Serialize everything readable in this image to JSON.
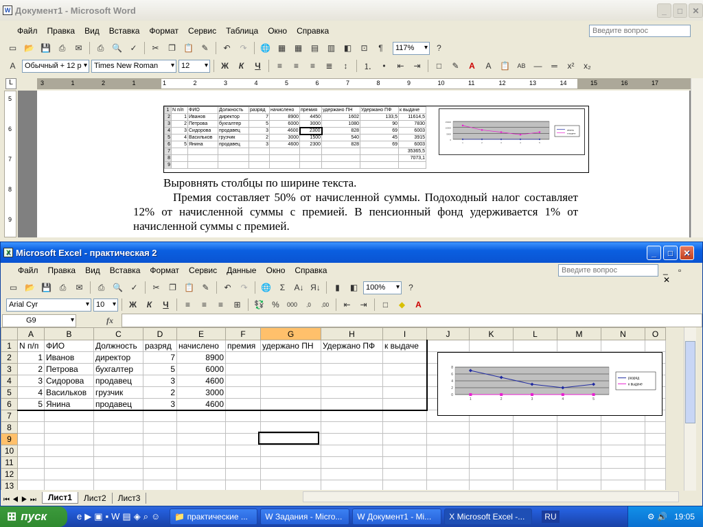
{
  "word": {
    "title": "Документ1 - Microsoft Word",
    "menu": [
      "Файл",
      "Правка",
      "Вид",
      "Вставка",
      "Формат",
      "Сервис",
      "Таблица",
      "Окно",
      "Справка"
    ],
    "help_placeholder": "Введите вопрос",
    "zoom": "117%",
    "style": "Обычный + 12 р",
    "font": "Times New Roman",
    "size": "12",
    "ruler_marks": [
      "3",
      "1",
      "2",
      "1",
      "1",
      "2",
      "3",
      "4",
      "5",
      "6",
      "7",
      "8",
      "9",
      "10",
      "11",
      "12",
      "13",
      "14",
      "15",
      "16",
      "17"
    ],
    "vruler_marks": [
      "5",
      "6",
      "7",
      "8",
      "9"
    ],
    "embedded": {
      "cols": [
        "",
        "N п/п",
        "ФИО",
        "Должность",
        "разряд",
        "начислено",
        "премия",
        "удержано ПН",
        "Удержано ПФ",
        "к выдаче"
      ],
      "rows": [
        [
          "1",
          "N п/п",
          "ФИО",
          "Должность",
          "разряд",
          "начислено",
          "премия",
          "удержано ПН",
          "Удержано ПФ",
          "к выдаче"
        ],
        [
          "2",
          "1",
          "Иванов",
          "директор",
          "7",
          "8900",
          "4450",
          "1602",
          "133,5",
          "11614,5"
        ],
        [
          "3",
          "2",
          "Петрова",
          "бухгалтер",
          "5",
          "6000",
          "3000",
          "1080",
          "90",
          "7830"
        ],
        [
          "4",
          "3",
          "Сидорова",
          "продавец",
          "3",
          "4600",
          "2300",
          "828",
          "69",
          "6003"
        ],
        [
          "5",
          "4",
          "Васильков",
          "грузчик",
          "2",
          "3000",
          "1500",
          "540",
          "45",
          "3915"
        ],
        [
          "6",
          "5",
          "Янина",
          "продавец",
          "3",
          "4600",
          "2300",
          "828",
          "69",
          "6003"
        ],
        [
          "7",
          "",
          "",
          "",
          "",
          "",
          "",
          "",
          "",
          "35365,5"
        ],
        [
          "8",
          "",
          "",
          "",
          "",
          "",
          "",
          "",
          "",
          "7073,1"
        ],
        [
          "9",
          "",
          "",
          "",
          "",
          "",
          "",
          "",
          "",
          ""
        ]
      ]
    },
    "text1": "Выровнять столбцы по ширине текста.",
    "text2": "Премия составляет 50% от начисленной суммы. Подоходный налог составляет 12% от начисленной суммы с премией. В пенсионный фонд удерживается 1% от начисленной суммы с премией."
  },
  "excel": {
    "title": "Microsoft Excel - практическая 2",
    "menu": [
      "Файл",
      "Правка",
      "Вид",
      "Вставка",
      "Формат",
      "Сервис",
      "Данные",
      "Окно",
      "Справка"
    ],
    "help_placeholder": "Введите вопрос",
    "zoom": "100%",
    "font": "Arial Cyr",
    "size": "10",
    "namebox": "G9",
    "fx": "fx",
    "columns": [
      "A",
      "B",
      "C",
      "D",
      "E",
      "F",
      "G",
      "H",
      "I",
      "J",
      "K",
      "L",
      "M",
      "N",
      "O"
    ],
    "rows": [
      [
        "1",
        "N п/п",
        "ФИО",
        "Должность",
        "разряд",
        "начислено",
        "премия",
        "удержано ПН",
        "Удержано ПФ",
        "к выдаче"
      ],
      [
        "2",
        "1",
        "Иванов",
        "директор",
        "7",
        "8900",
        "",
        "",
        "",
        ""
      ],
      [
        "3",
        "2",
        "Петрова",
        "бухгалтер",
        "5",
        "6000",
        "",
        "",
        "",
        ""
      ],
      [
        "4",
        "3",
        "Сидорова",
        "продавец",
        "3",
        "4600",
        "",
        "",
        "",
        ""
      ],
      [
        "5",
        "4",
        "Васильков",
        "грузчик",
        "2",
        "3000",
        "",
        "",
        "",
        ""
      ],
      [
        "6",
        "5",
        "Янина",
        "продавец",
        "3",
        "4600",
        "",
        "",
        "",
        ""
      ],
      [
        "7",
        "",
        "",
        "",
        "",
        "",
        "",
        "",
        "",
        ""
      ],
      [
        "8",
        "",
        "",
        "",
        "",
        "",
        "",
        "",
        "",
        ""
      ],
      [
        "9",
        "",
        "",
        "",
        "",
        "",
        "",
        "",
        "",
        ""
      ],
      [
        "10",
        "",
        "",
        "",
        "",
        "",
        "",
        "",
        "",
        ""
      ],
      [
        "11",
        "",
        "",
        "",
        "",
        "",
        "",
        "",
        "",
        ""
      ],
      [
        "12",
        "",
        "",
        "",
        "",
        "",
        "",
        "",
        "",
        ""
      ],
      [
        "13",
        "",
        "",
        "",
        "",
        "",
        "",
        "",
        "",
        ""
      ]
    ],
    "sheets": [
      "Лист1",
      "Лист2",
      "Лист3"
    ]
  },
  "chart_data": [
    {
      "type": "line",
      "categories": [
        "1",
        "2",
        "3",
        "4",
        "5"
      ],
      "series": [
        {
          "name": "разряд",
          "values": [
            7,
            5,
            3,
            2,
            3
          ]
        },
        {
          "name": "к выдаче",
          "values": [
            0,
            0,
            0,
            0,
            0
          ]
        }
      ],
      "yticks": [
        "0",
        "2",
        "4",
        "6",
        "8"
      ],
      "ylim": [
        0,
        8
      ],
      "grid": true,
      "legend": "right"
    },
    {
      "type": "line",
      "categories": [
        "1",
        "2",
        "3",
        "4",
        "5"
      ],
      "series": [
        {
          "name": "разряд",
          "values": [
            7,
            5,
            3,
            2,
            3
          ]
        },
        {
          "name": "к выдаче",
          "values": [
            11614.5,
            7830,
            6003,
            3915,
            6003
          ]
        }
      ],
      "yticks": [
        "0",
        "5000",
        "10000",
        "15000"
      ],
      "ylim": [
        0,
        15000
      ],
      "grid": true,
      "legend": "right"
    }
  ],
  "taskbar": {
    "start": "пуск",
    "buttons": [
      "практические ...",
      "Задания - Micro...",
      "Документ1 - Mi...",
      "Microsoft Excel -..."
    ],
    "lang": "RU",
    "clock": "19:05"
  },
  "colors": {
    "xp_blue": "#0a54d2",
    "series1": "#1f2aa0",
    "series2": "#e81ed0",
    "plot_bg": "#c0c0c0"
  }
}
